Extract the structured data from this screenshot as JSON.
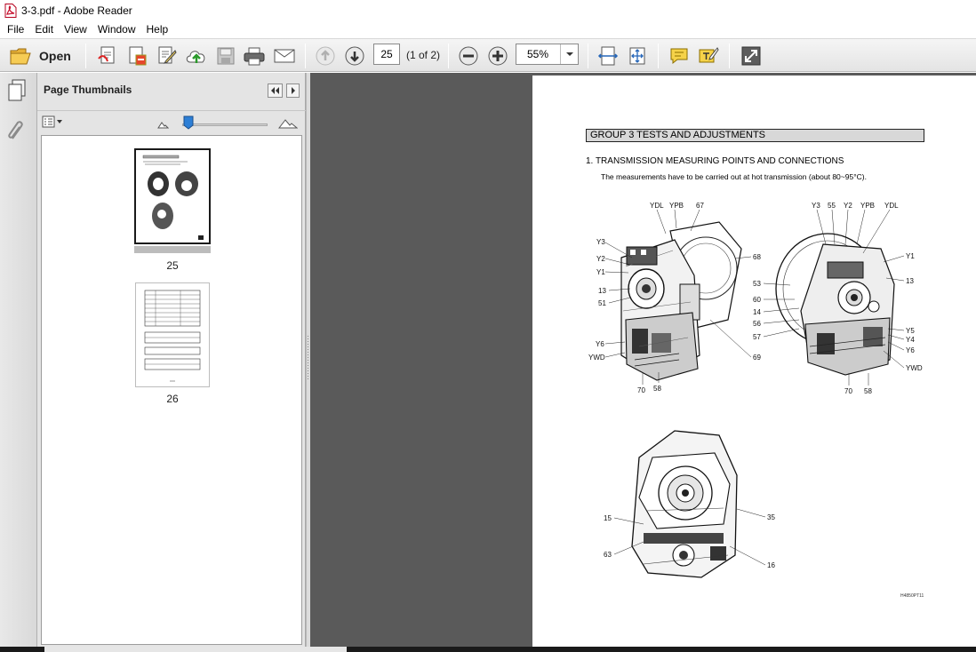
{
  "window": {
    "title": "3-3.pdf - Adobe Reader"
  },
  "menu": {
    "items": [
      "File",
      "Edit",
      "View",
      "Window",
      "Help"
    ]
  },
  "toolbar": {
    "open_label": "Open",
    "current_page": "25",
    "page_count": "(1 of 2)",
    "zoom": "55%",
    "icons": [
      "folder-open-icon",
      "create-pdf-icon",
      "convert-icon",
      "edit-icon",
      "upload-icon",
      "save-icon",
      "print-icon",
      "email-icon",
      "previous-page-icon",
      "next-page-icon",
      "zoom-out-icon",
      "zoom-in-icon",
      "fit-width-icon",
      "fit-page-icon",
      "comment-icon",
      "sign-icon",
      "fullscreen-icon"
    ]
  },
  "sidebar": {
    "title": "Page Thumbnails",
    "thumbnails": [
      {
        "label": "25",
        "selected": true
      },
      {
        "label": "26",
        "selected": false
      }
    ]
  },
  "document": {
    "group_heading": "GROUP  3  TESTS AND ADJUSTMENTS",
    "section_title": "1. TRANSMISSION MEASURING POINTS AND CONNECTIONS",
    "section_note": "The measurements have to be carried out at hot transmission (about 80~95°C).",
    "figure_code": "H4850PT11",
    "callouts_fig1": [
      "YDL",
      "YPB",
      "67",
      "Y3",
      "Y2",
      "Y1",
      "13",
      "51",
      "68",
      "Y6",
      "YWD",
      "70",
      "58",
      "69"
    ],
    "callouts_fig2": [
      "Y3",
      "55",
      "Y2",
      "YPB",
      "YDL",
      "Y1",
      "13",
      "53",
      "60",
      "14",
      "56",
      "57",
      "Y5",
      "Y4",
      "Y6",
      "YWD",
      "70",
      "58"
    ],
    "callouts_fig3": [
      "15",
      "35",
      "63",
      "16"
    ]
  }
}
